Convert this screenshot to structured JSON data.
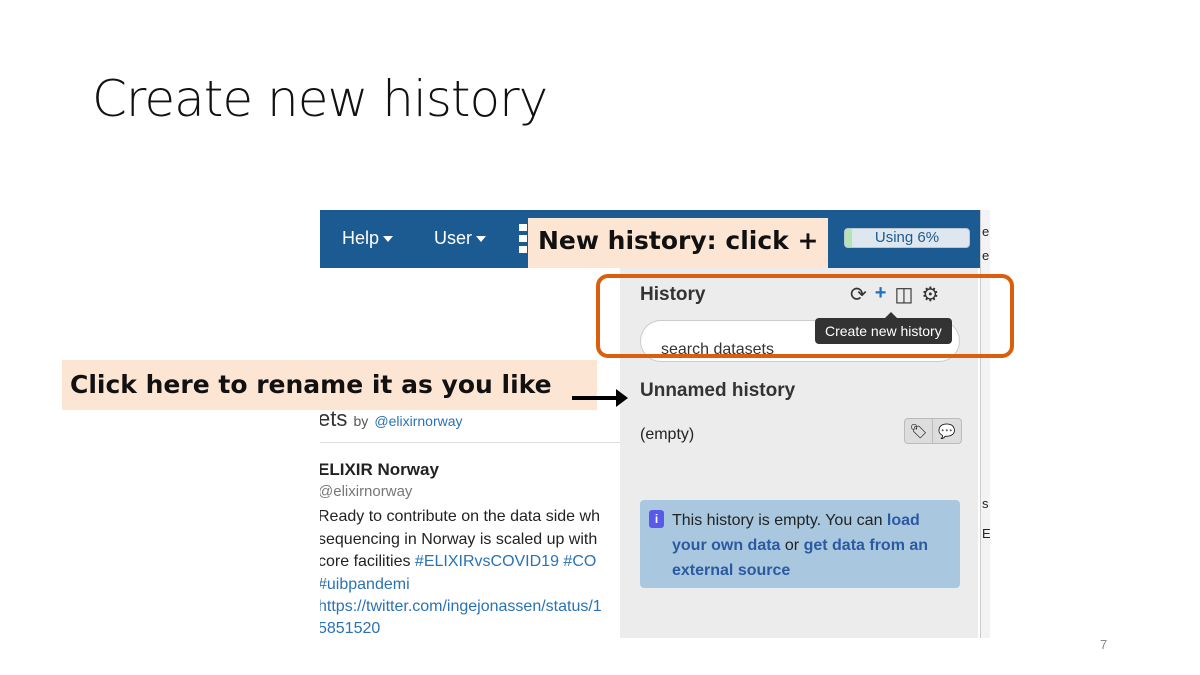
{
  "slide": {
    "title": "Create new history",
    "page_number": "7"
  },
  "callouts": {
    "new_history": "New history: click +",
    "rename": "Click here to rename it as you like"
  },
  "navbar": {
    "help": "Help",
    "user": "User",
    "quota": "Using 6%",
    "quota_percent": 6
  },
  "right_strip": [
    "e",
    "e",
    "s",
    "E"
  ],
  "history": {
    "header": "History",
    "icons": [
      "refresh-icon",
      "plus-icon",
      "columns-icon",
      "gear-icon"
    ],
    "search_placeholder": "search datasets",
    "tooltip": "Create new history",
    "name": "Unnamed history",
    "status": "(empty)",
    "info_text": "This history is empty. You can ",
    "info_link1": "load your own data",
    "info_or": " or ",
    "info_link2": "get data from an external source"
  },
  "tweets": {
    "header_fragment": "ets",
    "by": "by",
    "handle_link": "@elixirnorway",
    "author": "ELIXIR Norway",
    "author_handle": "@elixirnorway",
    "lines": [
      "Ready to contribute on the data side wh",
      "sequencing in Norway is scaled up with",
      "core facilities "
    ],
    "hashtags": "#ELIXIRvsCOVID19 #CO",
    "hashtag2": "#uibpandemi",
    "url1": "https://twitter.com/ingejonassen/status/1",
    "url2": "5851520"
  }
}
